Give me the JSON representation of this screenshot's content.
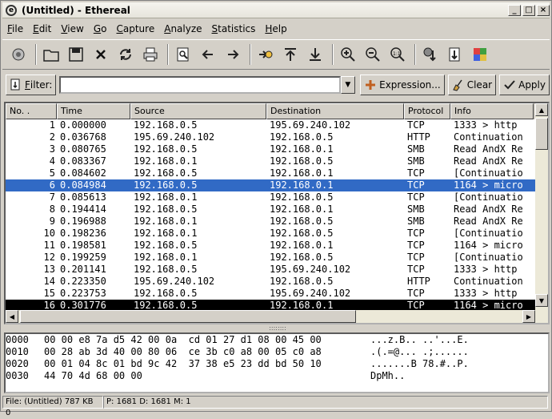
{
  "window": {
    "title": "(Untitled) - Ethereal",
    "app_icon": "ethereal-icon",
    "minimize": "_",
    "maximize": "□",
    "close": "×"
  },
  "menu": [
    {
      "u": "F",
      "rest": "ile"
    },
    {
      "u": "E",
      "rest": "dit"
    },
    {
      "u": "V",
      "rest": "iew"
    },
    {
      "u": "G",
      "rest": "o"
    },
    {
      "u": "C",
      "rest": "apture"
    },
    {
      "u": "A",
      "rest": "nalyze"
    },
    {
      "u": "S",
      "rest": "tatistics"
    },
    {
      "u": "H",
      "rest": "elp"
    }
  ],
  "filter": {
    "label_u": "F",
    "label_rest": "ilter:",
    "value": "",
    "expression_label": "Expression...",
    "clear_label": "Clear",
    "apply_label": "Apply"
  },
  "columns": [
    "No. .",
    "Time",
    "Source",
    "Destination",
    "Protocol",
    "Info"
  ],
  "packets": [
    {
      "no": "1",
      "time": "0.000000",
      "src": "192.168.0.5",
      "dst": "195.69.240.102",
      "proto": "TCP",
      "info": "1333 > http"
    },
    {
      "no": "2",
      "time": "0.036768",
      "src": "195.69.240.102",
      "dst": "192.168.0.5",
      "proto": "HTTP",
      "info": "Continuation"
    },
    {
      "no": "3",
      "time": "0.080765",
      "src": "192.168.0.5",
      "dst": "192.168.0.1",
      "proto": "SMB",
      "info": "Read AndX Re"
    },
    {
      "no": "4",
      "time": "0.083367",
      "src": "192.168.0.1",
      "dst": "192.168.0.5",
      "proto": "SMB",
      "info": "Read AndX Re"
    },
    {
      "no": "5",
      "time": "0.084602",
      "src": "192.168.0.5",
      "dst": "192.168.0.1",
      "proto": "TCP",
      "info": "[Continuatio"
    },
    {
      "no": "6",
      "time": "0.084984",
      "src": "192.168.0.5",
      "dst": "192.168.0.1",
      "proto": "TCP",
      "info": "1164 > micro"
    },
    {
      "no": "7",
      "time": "0.085613",
      "src": "192.168.0.1",
      "dst": "192.168.0.5",
      "proto": "TCP",
      "info": "[Continuatio"
    },
    {
      "no": "8",
      "time": "0.194414",
      "src": "192.168.0.5",
      "dst": "192.168.0.1",
      "proto": "SMB",
      "info": "Read AndX Re"
    },
    {
      "no": "9",
      "time": "0.196988",
      "src": "192.168.0.1",
      "dst": "192.168.0.5",
      "proto": "SMB",
      "info": "Read AndX Re"
    },
    {
      "no": "10",
      "time": "0.198236",
      "src": "192.168.0.1",
      "dst": "192.168.0.5",
      "proto": "TCP",
      "info": "[Continuatio"
    },
    {
      "no": "11",
      "time": "0.198581",
      "src": "192.168.0.5",
      "dst": "192.168.0.1",
      "proto": "TCP",
      "info": "1164 > micro"
    },
    {
      "no": "12",
      "time": "0.199259",
      "src": "192.168.0.1",
      "dst": "192.168.0.5",
      "proto": "TCP",
      "info": "[Continuatio"
    },
    {
      "no": "13",
      "time": "0.201141",
      "src": "192.168.0.5",
      "dst": "195.69.240.102",
      "proto": "TCP",
      "info": "1333 > http"
    },
    {
      "no": "14",
      "time": "0.223350",
      "src": "195.69.240.102",
      "dst": "192.168.0.5",
      "proto": "HTTP",
      "info": "Continuation"
    },
    {
      "no": "15",
      "time": "0.223753",
      "src": "192.168.0.5",
      "dst": "195.69.240.102",
      "proto": "TCP",
      "info": "1333 > http"
    },
    {
      "no": "16",
      "time": "0.301776",
      "src": "192.168.0.5",
      "dst": "192.168.0.1",
      "proto": "TCP",
      "info": "1164 > micro"
    }
  ],
  "selected_row": 5,
  "hex": [
    {
      "off": "0000",
      "bytes": "00 00 e8 7a d5 42 00 0a  cd 01 27 d1 08 00 45 00",
      "ascii": "...z.B.. ..'...E."
    },
    {
      "off": "0010",
      "bytes": "00 28 ab 3d 40 00 80 06  ce 3b c0 a8 00 05 c0 a8",
      "ascii": ".(.=@... .;......"
    },
    {
      "off": "0020",
      "bytes": "00 01 04 8c 01 bd 9c 42  37 38 e5 23 dd bd 50 10",
      "ascii": ".......B 78.#..P."
    },
    {
      "off": "0030",
      "bytes": "44 70 4d 68 00 00",
      "ascii": "DpMh.."
    }
  ],
  "status": {
    "left": "File: (Untitled) 787 KB 0",
    "right": "P: 1681 D: 1681 M: 1"
  },
  "colors": {
    "selection": "#316ac5",
    "chrome": "#d4d0c8"
  }
}
